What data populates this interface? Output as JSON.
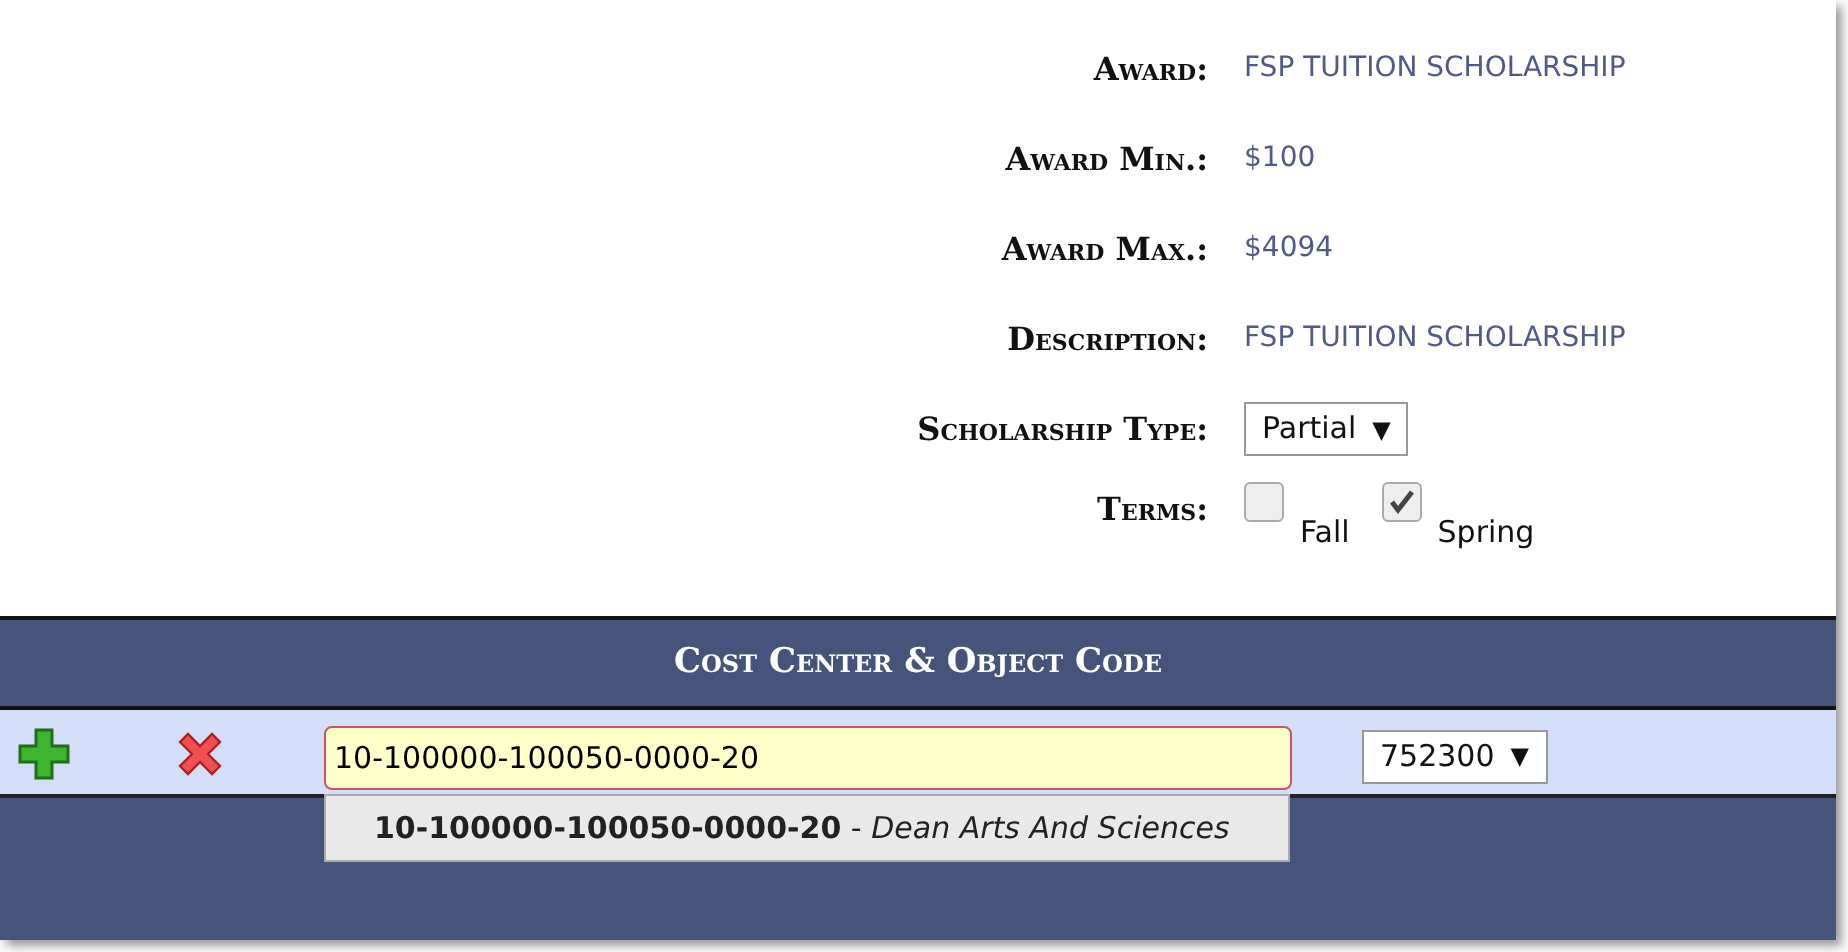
{
  "details": [
    {
      "label": "Award:",
      "kind": "text",
      "value": "FSP TUITION SCHOLARSHIP"
    },
    {
      "label": "Award Min.:",
      "kind": "text",
      "value": "$100"
    },
    {
      "label": "Award Max.:",
      "kind": "text",
      "value": "$4094"
    },
    {
      "label": "Description:",
      "kind": "text",
      "value": "FSP TUITION SCHOLARSHIP"
    },
    {
      "label": "Scholarship Type:",
      "kind": "select",
      "value": "Partial",
      "caret": "▼"
    },
    {
      "label": "Terms:",
      "kind": "checks",
      "options": [
        {
          "label": "Fall",
          "checked": false
        },
        {
          "label": "Spring",
          "checked": true
        }
      ]
    }
  ],
  "cost_center": {
    "title": "Cost Center & Object Code",
    "input": {
      "value": "10-100000-100050-0000-20"
    },
    "suggestion": "**10-100000-100050-0000-20** - *Dean Arts And Sciences*",
    "object_code": {
      "value": "752300",
      "caret": "▼"
    }
  }
}
